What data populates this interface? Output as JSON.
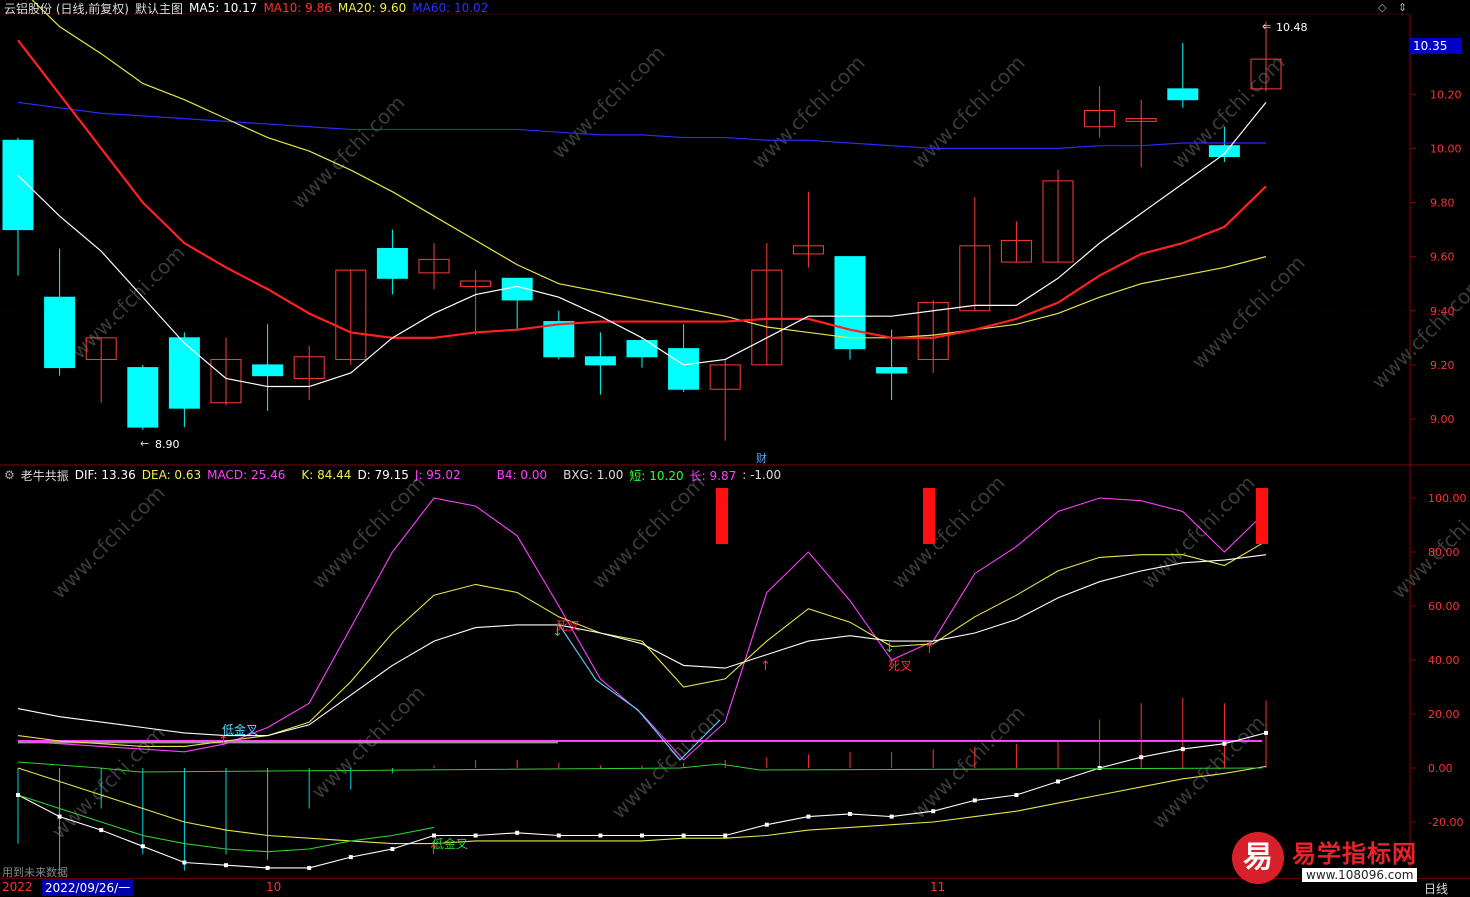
{
  "main_panel": {
    "title": "云铝股份 (日线,前复权)",
    "view_name": "默认主图",
    "ma5": "MA5: 10.17",
    "ma10": "MA10: 9.86",
    "ma20": "MA20: 9.60",
    "ma60": "MA60: 10.02",
    "current_price_box": "10.35",
    "high_marker": "10.48",
    "low_marker": "8.90",
    "finance_marker": "财",
    "y_ticks": [
      "10.20",
      "10.00",
      "9.80",
      "9.60",
      "9.40",
      "9.20",
      "9.00"
    ],
    "colors": {
      "ma5": "#ffffff",
      "ma10": "#ff2020",
      "ma20": "#e6e64a",
      "ma60": "#2020e6",
      "up": "#ff3b3b",
      "down": "#00ffff"
    }
  },
  "indicator_panel": {
    "title": "老牛共振",
    "dif": "DIF: 13.36",
    "dea": "DEA: 0.63",
    "macd": "MACD: 25.46",
    "k": "K: 84.44",
    "d": "D: 79.15",
    "j": "J: 95.02",
    "b4": "B4: 0.00",
    "bxg": "BXG: 1.00",
    "short": "短: 10.20",
    "long": "长: 9.87",
    "extra": ": -1.00",
    "y_ticks": [
      "100.00",
      "80.00",
      "60.00",
      "40.00",
      "20.00",
      "0.00",
      "-20.00"
    ],
    "labels": {
      "low_golden_cross_1": "低金叉",
      "low_golden_cross_2": "低金叉",
      "death_cross_1": "死叉",
      "death_cross_2": "死叉"
    },
    "future_data_note": "用到未来数据"
  },
  "bottom_axis": {
    "year": "2022",
    "date_cursor": "2022/09/26/一",
    "month_10": "10",
    "month_11": "11",
    "period": "日线"
  },
  "watermark": "www.cfchi.com",
  "brand": {
    "logo_char": "易",
    "name": "易学指标网",
    "url": "www.108096.com"
  }
}
